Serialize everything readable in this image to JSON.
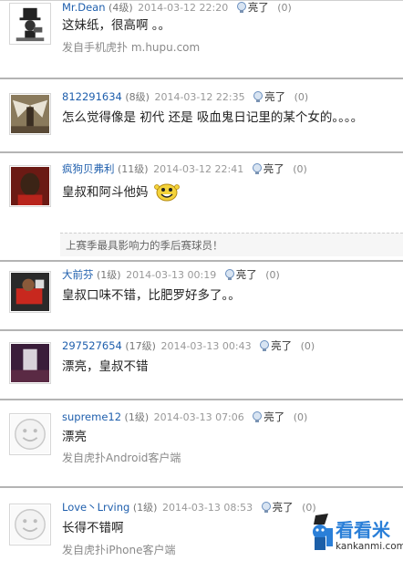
{
  "ui": {
    "lightup_label": "亮了"
  },
  "comments": [
    {
      "username": "Mr.Dean",
      "level": "(4级)",
      "time": "2014-03-12 22:20",
      "count": "(0)",
      "text": "这妹纸，很高啊 。。",
      "source": "发自手机虎扑  m.hupu.com",
      "avatar": "top-hat-character"
    },
    {
      "username": "812291634",
      "level": "(8级)",
      "time": "2014-03-12 22:35",
      "count": "(0)",
      "text": "怎么觉得像是 初代 还是 吸血鬼日记里的某个女的。。。。",
      "source": "",
      "avatar": "winged-figure"
    },
    {
      "username": "疯狗贝弗利",
      "level": "(11级)",
      "time": "2014-03-12 22:41",
      "count": "(0)",
      "text": "皇叔和阿斗他妈",
      "source": "",
      "avatar": "player-portrait",
      "related": "上赛季最具影响力的季后赛球员！"
    },
    {
      "username": "大前芬",
      "level": "(1级)",
      "time": "2014-03-13 00:19",
      "count": "(0)",
      "text": "皇叔口味不错，比肥罗好多了。。",
      "source": "",
      "avatar": "red-jersey-player"
    },
    {
      "username": "297527654",
      "level": "(17级)",
      "time": "2014-03-13 00:43",
      "count": "(0)",
      "text": "漂亮，皇叔不错",
      "source": "",
      "avatar": "dark-photo"
    },
    {
      "username": "supreme12",
      "level": "(1级)",
      "time": "2014-03-13 07:06",
      "count": "(0)",
      "text": "漂亮",
      "source": "发自虎扑Android客户端",
      "avatar": "default-face"
    },
    {
      "username": "Love丶Lrving",
      "level": "(1级)",
      "time": "2014-03-13 08:53",
      "count": "(0)",
      "text": "长得不错啊",
      "source": "发自虎扑iPhone客户端",
      "avatar": "default-face"
    }
  ],
  "watermark": {
    "title": "看看米",
    "url": "kankanmi.com"
  },
  "colors": {
    "username": "#1f5fad",
    "separator": "#b4b4b4",
    "watermark": "#2a7fd8"
  }
}
